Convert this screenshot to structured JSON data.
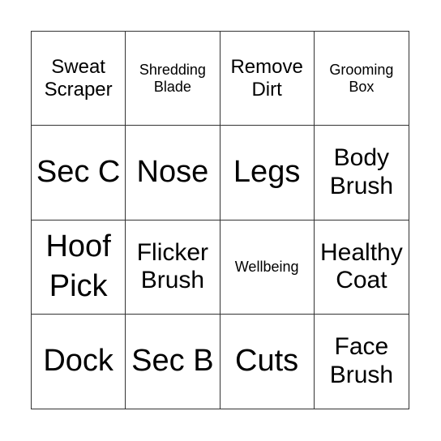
{
  "board": {
    "cells": [
      "Sweat Scraper",
      "Shredding Blade",
      "Remove Dirt",
      "Grooming Box",
      "Sec C",
      "Nose",
      "Legs",
      "Body Brush",
      "Hoof Pick",
      "Flicker Brush",
      "Wellbeing",
      "Healthy Coat",
      "Dock",
      "Sec B",
      "Cuts",
      "Face Brush"
    ]
  }
}
